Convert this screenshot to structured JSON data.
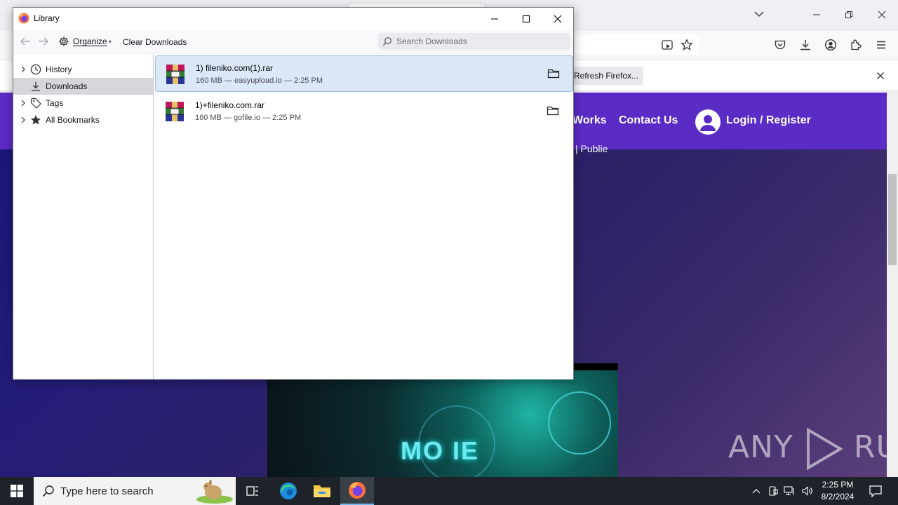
{
  "background_browser": {
    "notification": {
      "button_label": "Refresh Firefox..."
    },
    "site": {
      "nav_partial": "Works",
      "nav_contact": "Contact Us",
      "nav_login": "Login / Register",
      "subtext_partial": "| Publie",
      "video_title_partial": "MO  IE",
      "brand_color": "#5b2bc6"
    },
    "watermark": {
      "left": "ANY",
      "right": "RUN"
    }
  },
  "library": {
    "title": "Library",
    "toolbar": {
      "organize_label": "Organize",
      "clear_downloads_label": "Clear Downloads",
      "search_placeholder": "Search Downloads"
    },
    "sidebar": {
      "items": [
        {
          "label": "History",
          "icon": "clock-icon",
          "expandable": true,
          "selected": false
        },
        {
          "label": "Downloads",
          "icon": "download-icon",
          "expandable": false,
          "selected": true
        },
        {
          "label": "Tags",
          "icon": "tag-icon",
          "expandable": true,
          "selected": false
        },
        {
          "label": "All Bookmarks",
          "icon": "star-icon",
          "expandable": true,
          "selected": false
        }
      ]
    },
    "downloads": [
      {
        "name": "1) fileniko.com(1).rar",
        "meta": "160 MB — easyupload.io — 2:25 PM",
        "icon": "winrar-archive-icon",
        "selected": true
      },
      {
        "name": "1)+fileniko.com.rar",
        "meta": "160 MB — gofile.io — 2:25 PM",
        "icon": "winrar-archive-icon",
        "selected": false
      }
    ]
  },
  "taskbar": {
    "search_placeholder": "Type here to search",
    "clock_time": "2:25 PM",
    "clock_date": "8/2/2024",
    "pinned_apps": [
      "task-view-icon",
      "edge-icon",
      "file-explorer-icon",
      "firefox-icon"
    ],
    "active_app": "firefox-icon"
  }
}
